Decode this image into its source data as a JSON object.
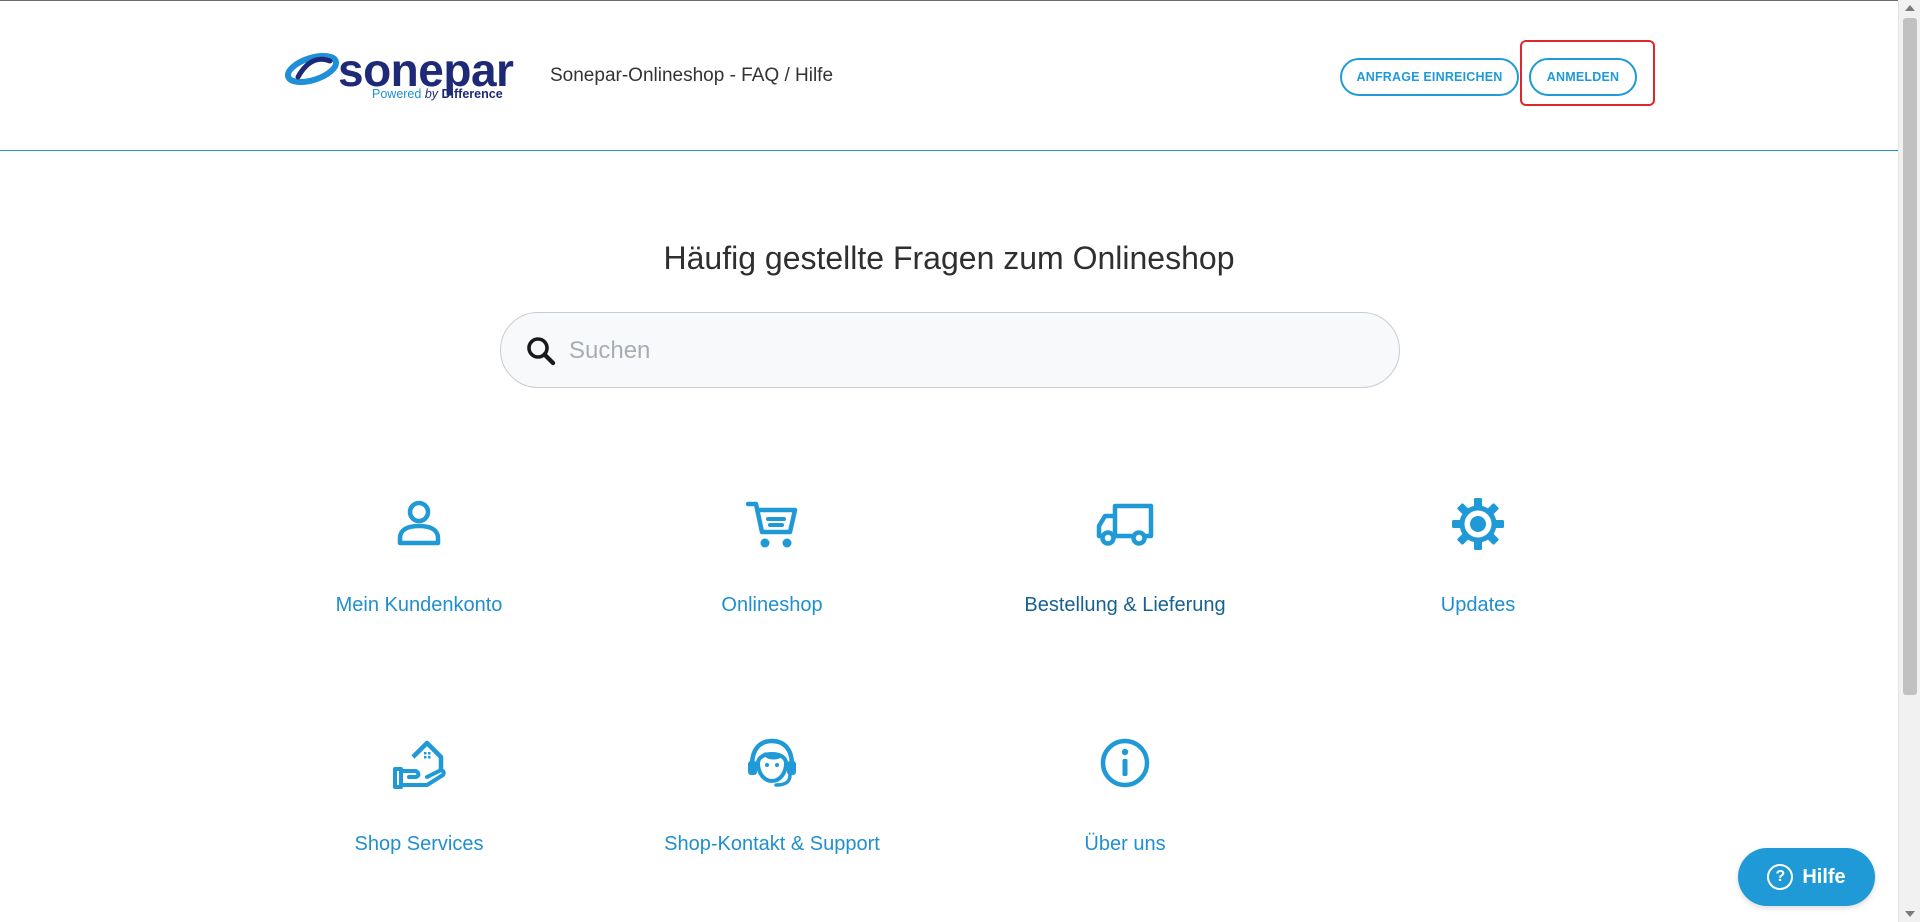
{
  "header": {
    "logo_word": "sonepar",
    "logo_tag_powered": "Powered",
    "logo_tag_by": "by",
    "logo_tag_difference": "Difference",
    "title": "Sonepar-Onlineshop - FAQ / Hilfe",
    "request_button": "ANFRAGE EINREICHEN",
    "login_button": "ANMELDEN"
  },
  "main": {
    "heading": "Häufig gestellte Fragen zum Onlineshop",
    "search": {
      "placeholder": "Suchen",
      "value": ""
    },
    "categories": [
      {
        "label": "Mein Kundenkonto",
        "icon": "user-icon"
      },
      {
        "label": "Onlineshop",
        "icon": "cart-icon"
      },
      {
        "label": "Bestellung & Lieferung",
        "icon": "truck-icon"
      },
      {
        "label": "Updates",
        "icon": "gear-icon"
      },
      {
        "label": "Shop Services",
        "icon": "hand-house-icon"
      },
      {
        "label": "Shop-Kontakt & Support",
        "icon": "headset-icon"
      },
      {
        "label": "Über uns",
        "icon": "info-icon"
      }
    ]
  },
  "help_widget": {
    "label": "Hilfe",
    "glyph": "?"
  },
  "colors": {
    "accent": "#1f9ad6",
    "brand_navy": "#1e2a78",
    "highlight": "#e0262b"
  }
}
